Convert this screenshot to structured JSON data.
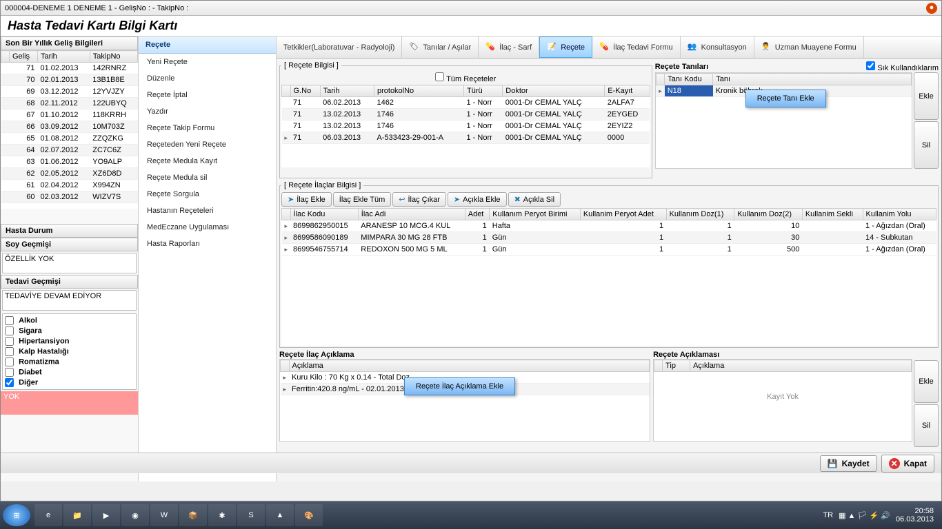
{
  "window_title": "000004-DENEME 1 DENEME 1 - GelişNo :  - TakipNo :",
  "heading": "Hasta Tedavi Kartı Bilgi Kartı",
  "left": {
    "visits_title": "Son Bir Yıllık Geliş Bilgileri",
    "cols": [
      "Geliş",
      "Tarih",
      "TakipNo"
    ],
    "rows": [
      [
        "71",
        "01.02.2013",
        "142RNRZ"
      ],
      [
        "70",
        "02.01.2013",
        "13B1B8E"
      ],
      [
        "69",
        "03.12.2012",
        "12YVJZY"
      ],
      [
        "68",
        "02.11.2012",
        "122UBYQ"
      ],
      [
        "67",
        "01.10.2012",
        "118KRRH"
      ],
      [
        "66",
        "03.09.2012",
        "10M703Z"
      ],
      [
        "65",
        "01.08.2012",
        "ZZQZKG"
      ],
      [
        "64",
        "02.07.2012",
        "ZC7C6Z"
      ],
      [
        "63",
        "01.06.2012",
        "YO9ALP"
      ],
      [
        "62",
        "02.05.2012",
        "XZ6D8D"
      ],
      [
        "61",
        "02.04.2012",
        "X994ZN"
      ],
      [
        "60",
        "02.03.2012",
        "WIZV7S"
      ]
    ],
    "hasta_durum": "Hasta Durum",
    "soy_title": "Soy Geçmişi",
    "soy_value": "ÖZELLİK YOK",
    "tedavi_title": "Tedavi Geçmişi",
    "tedavi_value": "TEDAVİYE DEVAM EDİYOR",
    "checks": [
      "Alkol",
      "Sigara",
      "Hipertansiyon",
      "Kalp Hastalığı",
      "Romatizma",
      "Diabet",
      "Diğer"
    ],
    "red_value": "YOK"
  },
  "menu": {
    "header": "Reçete",
    "items": [
      "Yeni Reçete",
      "Düzenle",
      "Reçete İptal",
      "Yazdır",
      "Reçete Takip Formu",
      "Reçeteden Yeni Reçete",
      "Reçete Medula Kayıt",
      "Reçete Medula sil",
      "Reçete Sorgula",
      "Hastanın Reçeteleri",
      "MedEczane Uygulaması",
      "Hasta Raporları"
    ]
  },
  "tabs": [
    "Tetkikler(Laboratuvar - Radyoloji)",
    "Tanılar / Aşılar",
    "İlaç - Sarf",
    "Reçete",
    "İlaç Tedavi Formu",
    "Konsultasyon",
    "Uzman Muayene Formu"
  ],
  "recete_bilgisi": {
    "legend": "[ Reçete Bilgisi ]",
    "all_check": "Tüm Reçeteler",
    "cols": [
      "G.No",
      "Tarih",
      "protokolNo",
      "Türü",
      "Doktor",
      "E-Kayıt"
    ],
    "rows": [
      [
        "71",
        "06.02.2013",
        "1462",
        "1 - Norr",
        "0001-Dr CEMAL YALÇ",
        "2ALFA7"
      ],
      [
        "71",
        "13.02.2013",
        "1746",
        "1 - Norr",
        "0001-Dr CEMAL YALÇ",
        "2EYGED"
      ],
      [
        "71",
        "13.02.2013",
        "1746",
        "1 - Norr",
        "0001-Dr CEMAL YALÇ",
        "2EYIZ2"
      ],
      [
        "71",
        "06.03.2013",
        "A-533423-29-001-A",
        "1 - Norr",
        "0001-Dr CEMAL YALÇ",
        "0000"
      ]
    ]
  },
  "tanilar": {
    "title": "Reçete Tanıları",
    "sik_label": "Sık Kullandıklarım",
    "cols": [
      "Tanı Kodu",
      "Tanı"
    ],
    "row": [
      "N18",
      "Kronik böbrek"
    ],
    "popup": "Reçete Tanı Ekle",
    "ekle": "Ekle",
    "sil": "Sil"
  },
  "ilaclar": {
    "legend": "[ Reçete İlaçlar Bilgisi ]",
    "buttons": [
      "İlaç Ekle",
      "İlaç Ekle Tüm",
      "İlaç Çıkar",
      "Açıkla Ekle",
      "Açıkla Sil"
    ],
    "cols": [
      "İlac Kodu",
      "İlac Adi",
      "Adet",
      "Kullanım Peryot Birimi",
      "Kullanim Peryot Adet",
      "Kullanım Doz(1)",
      "Kullanım Doz(2)",
      "Kullanim Sekli",
      "Kullanim Yolu"
    ],
    "rows": [
      [
        "8699862950015",
        "ARANESP 10 MCG.4 KUL",
        "1",
        "Hafta",
        "1",
        "1",
        "10",
        "",
        "1 - Ağızdan (Oral)"
      ],
      [
        "8699586090189",
        "MIMPARA 30 MG 28 FTB",
        "1",
        "Gün",
        "1",
        "1",
        "30",
        "",
        "14 - Subkutan"
      ],
      [
        "8699546755714",
        "REDOXON 500 MG 5 ML",
        "1",
        "Gün",
        "1",
        "1",
        "500",
        "",
        "1 - Ağızdan (Oral)"
      ]
    ]
  },
  "aciklama": {
    "title1": "Reçete İlaç Açıklama",
    "col1": "Açıklama",
    "rows": [
      "Kuru Kilo : 70 Kg x 0.14 - Total Doz",
      "Ferritin:420.8 ng/mL - 02.01.2013                                                % - 06.02.2013 - Transf"
    ],
    "popup": "Reçete İlaç Açıklama Ekle",
    "title2": "Reçete Açıklaması",
    "cols2": [
      "Tip",
      "Açıklama"
    ],
    "nodata": "Kayıt Yok",
    "ekle": "Ekle",
    "sil": "Sil"
  },
  "footer": {
    "kaydet": "Kaydet",
    "kapat": "Kapat"
  },
  "taskbar": {
    "lang": "TR",
    "time": "20:58",
    "date": "06.03.2013"
  }
}
